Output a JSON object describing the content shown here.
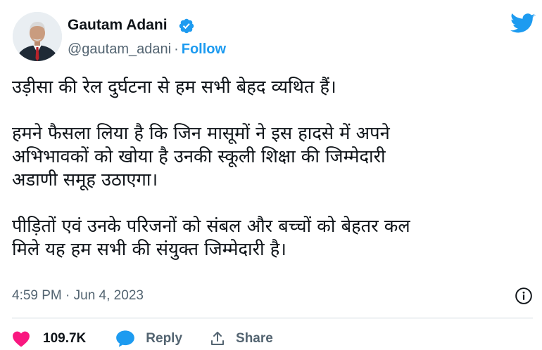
{
  "author": {
    "display_name": "Gautam Adani",
    "handle": "@gautam_adani",
    "separator": "·",
    "follow_label": "Follow"
  },
  "tweet": {
    "paragraphs": [
      "उड़ीसा की रेल दुर्घटना से हम सभी बेहद व्यथित हैं।",
      "हमने फैसला लिया है कि जिन मासूमों ने इस हादसे में अपने\nअभिभावकों को खोया है उनकी स्कूली शिक्षा की जिम्मेदारी\nअडाणी समूह उठाएगा।",
      "पीड़ितों एवं उनके परिजनों को संबल और बच्चों को बेहतर कल\nमिले यह हम सभी की संयुक्त जिम्मेदारी है।"
    ],
    "timestamp": "4:59 PM · Jun 4, 2023"
  },
  "actions": {
    "like_count": "109.7K",
    "reply_label": "Reply",
    "share_label": "Share"
  },
  "colors": {
    "accent": "#1d9bf0",
    "like": "#f91880",
    "muted": "#536471",
    "text": "#0f1419"
  },
  "icons": {
    "verified": "verified-badge-icon",
    "brand": "twitter-bird-icon",
    "info": "info-icon",
    "like": "heart-icon",
    "reply": "speech-bubble-icon",
    "share": "share-upload-icon"
  }
}
